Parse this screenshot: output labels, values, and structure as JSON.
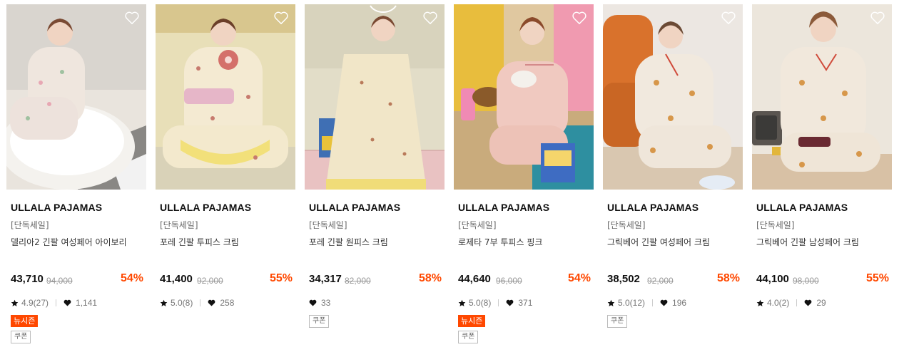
{
  "products": [
    {
      "brand": "ULLALA PAJAMAS",
      "tag": "[단독세일]",
      "name": "델리아2 긴팔 여성페어 아이보리",
      "price": "43,710",
      "original_price": "94,000",
      "discount": "54%",
      "rating": "4.9(27)",
      "likes": "1,141",
      "badges": [
        "뉴시즌",
        "쿠폰"
      ]
    },
    {
      "brand": "ULLALA PAJAMAS",
      "tag": "[단독세일]",
      "name": "포레 긴팔 투피스 크림",
      "price": "41,400",
      "original_price": "92,000",
      "discount": "55%",
      "rating": "5.0(8)",
      "likes": "258",
      "badges": []
    },
    {
      "brand": "ULLALA PAJAMAS",
      "tag": "[단독세일]",
      "name": "포레 긴팔 원피스 크림",
      "price": "34,317",
      "original_price": "82,000",
      "discount": "58%",
      "rating": "",
      "likes": "33",
      "badges": [
        "쿠폰"
      ]
    },
    {
      "brand": "ULLALA PAJAMAS",
      "tag": "[단독세일]",
      "name": "로제타 7부 투피스 핑크",
      "price": "44,640",
      "original_price": "96,000",
      "discount": "54%",
      "rating": "5.0(8)",
      "likes": "371",
      "badges": [
        "뉴시즌",
        "쿠폰"
      ]
    },
    {
      "brand": "ULLALA PAJAMAS",
      "tag": "[단독세일]",
      "name": "그릭베어 긴팔 여성페어 크림",
      "price": "38,502",
      "original_price": "92,000",
      "discount": "58%",
      "rating": "5.0(12)",
      "likes": "196",
      "badges": [
        "쿠폰"
      ]
    },
    {
      "brand": "ULLALA PAJAMAS",
      "tag": "[단독세일]",
      "name": "그릭베어 긴팔 남성페어 크림",
      "price": "44,100",
      "original_price": "98,000",
      "discount": "55%",
      "rating": "4.0(2)",
      "likes": "29",
      "badges": []
    }
  ],
  "colors": {
    "discount": "#ff4800",
    "new_season_badge": "#ff4800",
    "text_primary": "#111111",
    "text_muted": "#999999"
  },
  "icons": {
    "wishlist": "heart-outline-icon",
    "rating": "star-icon",
    "likes": "heart-filled-icon"
  }
}
